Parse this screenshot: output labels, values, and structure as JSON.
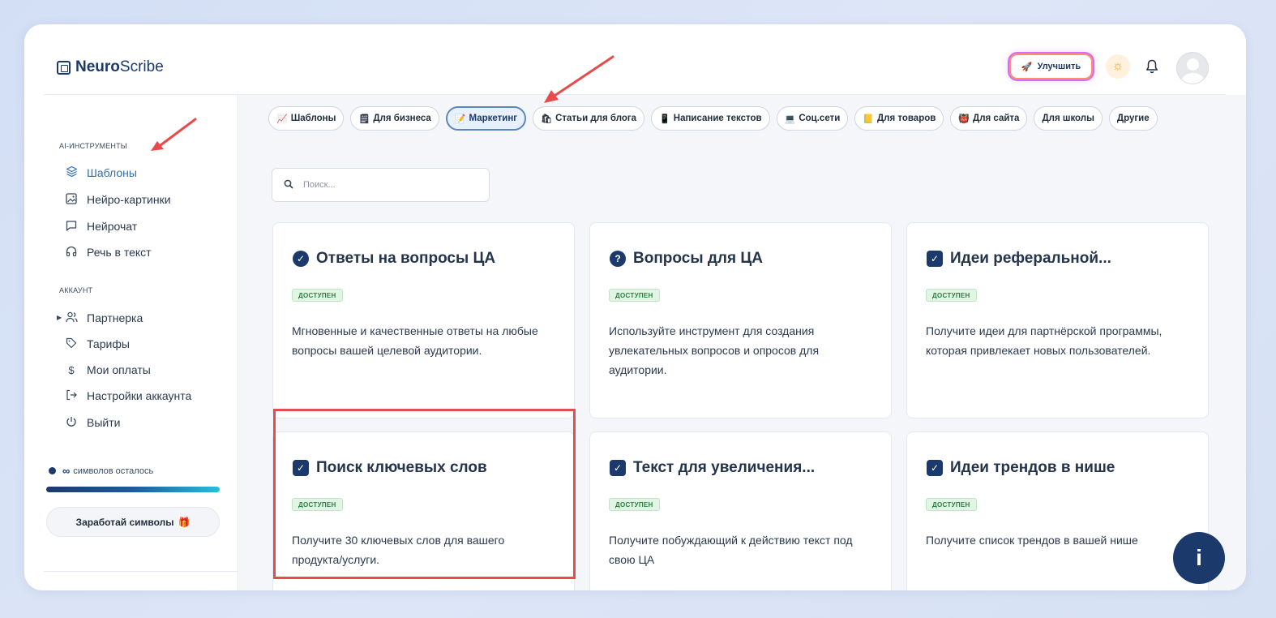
{
  "app": {
    "logo_bold": "Neuro",
    "logo_regular": "Scribe"
  },
  "header": {
    "upgrade_label": "Улучшить",
    "theme_icon": "sun-icon",
    "bell_icon": "bell-icon"
  },
  "sidebar": {
    "section_tools": "AI-инструменты",
    "tools": [
      {
        "label": "Шаблоны",
        "icon": "layers-icon",
        "active": true
      },
      {
        "label": "Нейро-картинки",
        "icon": "image-icon"
      },
      {
        "label": "Нейрочат",
        "icon": "chat-icon"
      },
      {
        "label": "Речь в текст",
        "icon": "headphones-icon"
      }
    ],
    "section_account": "Аккаунт",
    "account": [
      {
        "label": "Партнерка",
        "icon": "users-icon"
      },
      {
        "label": "Тарифы",
        "icon": "tag-icon"
      },
      {
        "label": "Мои оплаты",
        "icon": "dollar-icon"
      },
      {
        "label": "Настройки аккаунта",
        "icon": "logout-arrow-icon"
      },
      {
        "label": "Выйти",
        "icon": "power-icon"
      }
    ],
    "credits_symbol": "∞",
    "credits_text": "символов осталось",
    "credits_fill": 1.0,
    "earn_label": "Заработай символы",
    "earn_emoji": "🎁"
  },
  "chips": [
    {
      "label": "Шаблоны",
      "icon": "📈"
    },
    {
      "label": "Для бизнеса",
      "icon": "🗒"
    },
    {
      "label": "Маркетинг",
      "icon": "📝",
      "active": true
    },
    {
      "label": "Статьи для блога",
      "icon": "🛍"
    },
    {
      "label": "Написание текстов",
      "icon": "📱"
    },
    {
      "label": "Соц.сети",
      "icon": "💻"
    },
    {
      "label": "Для товаров",
      "icon": "📒"
    },
    {
      "label": "Для сайта",
      "icon": "👹"
    },
    {
      "label": "Для школы",
      "icon": ""
    },
    {
      "label": "Другие",
      "icon": ""
    }
  ],
  "search": {
    "placeholder": "Поиск..."
  },
  "cards": [
    {
      "title": "Ответы на вопросы ЦА",
      "icon": "check-circle-icon",
      "badge": "доступен",
      "desc": "Мгновенные и качественные ответы на любые вопросы вашей целевой аудитории."
    },
    {
      "title": "Вопросы для ЦА",
      "icon": "question-circle-icon",
      "badge": "доступен",
      "desc": "Используйте инструмент для создания увлекательных вопросов и опросов для аудитории."
    },
    {
      "title": "Идеи реферальной...",
      "icon": "checkbox-icon",
      "badge": "доступен",
      "desc": "Получите идеи для партнёрской программы, которая привлекает новых пользователей."
    },
    {
      "title": "Поиск ключевых слов",
      "icon": "checkbox-icon",
      "badge": "доступен",
      "desc": "Получите 30 ключевых слов для вашего продукта/услуги."
    },
    {
      "title": "Текст для увеличения...",
      "icon": "checkbox-icon",
      "badge": "доступен",
      "desc": "Получите побуждающий к действию текст под свою ЦА"
    },
    {
      "title": "Идеи трендов в нише",
      "icon": "checkbox-icon",
      "badge": "доступен",
      "desc": "Получите список трендов в вашей нише"
    }
  ],
  "help": {
    "icon": "info-icon"
  },
  "colors": {
    "brand": "#1b3a6b",
    "accent": "#2f6fb3",
    "highlight": "#e84b4b",
    "badge_bg": "#e1f5e4",
    "badge_text": "#2e7d40"
  }
}
